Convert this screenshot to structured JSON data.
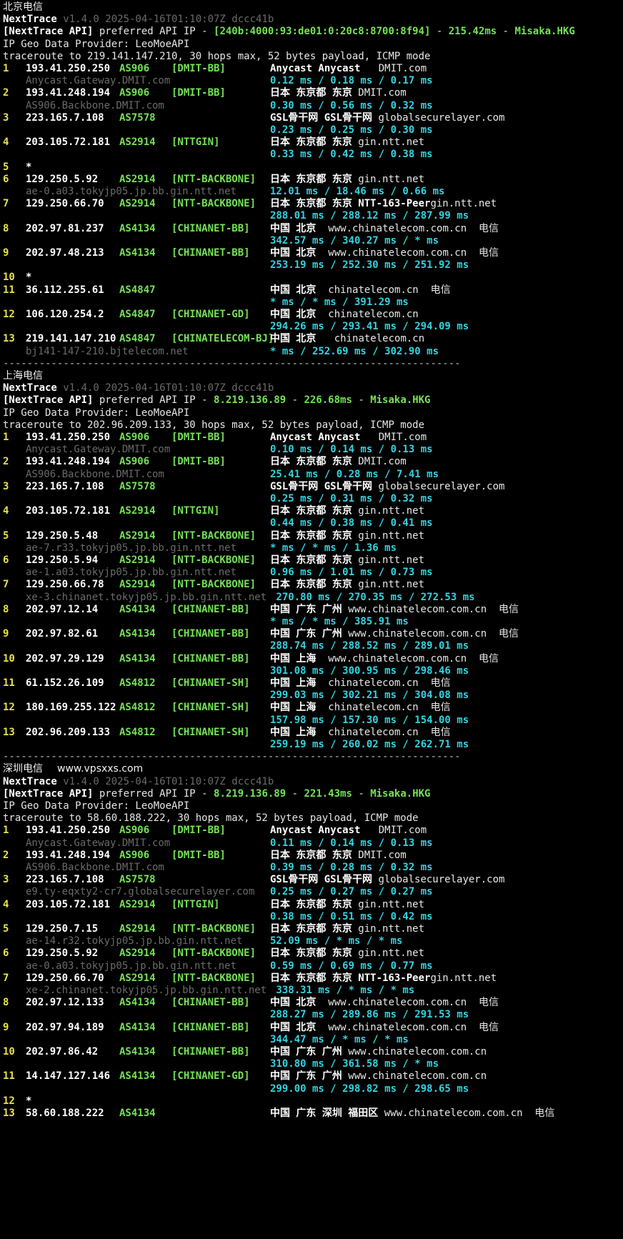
{
  "colors": {
    "background": "#000000",
    "text": "#e6e6e6",
    "cyan": "#33d3e0",
    "green": "#74e255",
    "yellow": "#e8e24a",
    "dim": "#6a6a6a"
  },
  "sections": [
    {
      "title": "北京电信",
      "site": "",
      "tool": "NextTrace",
      "version": "v1.4.0 2025-04-16T01:10:07Z dccc41b",
      "api_label": "[NextTrace API]",
      "api_text": " preferred API IP - ",
      "api_ip": "[240b:4000:93:de01:0:20c8:8700:8f94]",
      "api_sep1": " - ",
      "api_latency": "215.42ms",
      "api_sep2": " - ",
      "api_node": "Misaka.HKG",
      "geo_provider": "IP Geo Data Provider: LeoMoeAPI",
      "traceroute": "traceroute to 219.141.147.210, 30 hops max, 52 bytes payload, ICMP mode",
      "hops": [
        {
          "n": "1",
          "ip": "193.41.250.250",
          "asn": "AS906",
          "tag": "[DMIT-BB]",
          "geo": "Anycast Anycast ",
          "org": "  DMIT.com",
          "rdns": "Anycast.Gateway.DMIT.com",
          "rtt": "0.12 ms / 0.18 ms / 0.17 ms"
        },
        {
          "n": "2",
          "ip": "193.41.248.194",
          "asn": "AS906",
          "tag": "[DMIT-BB]",
          "geo": "日本 东京都 东京 ",
          "org": "DMIT.com",
          "rdns": "AS906.Backbone.DMIT.com",
          "rtt": "0.30 ms / 0.56 ms / 0.32 ms"
        },
        {
          "n": "3",
          "ip": "223.165.7.108",
          "asn": "AS7578",
          "tag": "",
          "geo": "GSL骨干网 GSL骨干网 ",
          "org": "globalsecurelayer.com",
          "rdns": "",
          "rtt": "0.23 ms / 0.25 ms / 0.30 ms"
        },
        {
          "n": "4",
          "ip": "203.105.72.181",
          "asn": "AS2914",
          "tag": "[NTTGIN]",
          "geo": "日本 东京都 东京 ",
          "org": "gin.ntt.net",
          "rdns": "",
          "rtt": "0.33 ms / 0.42 ms / 0.38 ms"
        },
        {
          "n": "5",
          "ip": "*",
          "asn": "",
          "tag": "",
          "geo": "",
          "org": "",
          "rdns": "",
          "rtt": ""
        },
        {
          "n": "6",
          "ip": "129.250.5.92",
          "asn": "AS2914",
          "tag": "[NTT-BACKBONE]",
          "geo": "日本 东京都 东京 ",
          "org": "gin.ntt.net",
          "rdns": "ae-0.a03.tokyjp05.jp.bb.gin.ntt.net",
          "rtt": "12.01 ms / 18.46 ms / 0.66 ms"
        },
        {
          "n": "7",
          "ip": "129.250.66.70",
          "asn": "AS2914",
          "tag": "[NTT-BACKBONE]",
          "geo": "日本 东京都 东京 NTT-163-Peer",
          "org": "gin.ntt.net",
          "rdns": "",
          "rtt": "288.01 ms / 288.12 ms / 287.99 ms"
        },
        {
          "n": "8",
          "ip": "202.97.81.237",
          "asn": "AS4134",
          "tag": "[CHINANET-BB]",
          "geo": "中国 北京  ",
          "org": "www.chinatelecom.com.cn  电信",
          "rdns": "",
          "rtt": "342.57 ms / 340.27 ms / * ms"
        },
        {
          "n": "9",
          "ip": "202.97.48.213",
          "asn": "AS4134",
          "tag": "[CHINANET-BB]",
          "geo": "中国 北京  ",
          "org": "www.chinatelecom.com.cn  电信",
          "rdns": "",
          "rtt": "253.19 ms / 252.30 ms / 251.92 ms"
        },
        {
          "n": "10",
          "ip": "*",
          "asn": "",
          "tag": "",
          "geo": "",
          "org": "",
          "rdns": "",
          "rtt": ""
        },
        {
          "n": "11",
          "ip": "36.112.255.61",
          "asn": "AS4847",
          "tag": "",
          "geo": "中国 北京  ",
          "org": "chinatelecom.cn  电信",
          "rdns": "",
          "rtt": "* ms / * ms / 391.29 ms"
        },
        {
          "n": "12",
          "ip": "106.120.254.2",
          "asn": "AS4847",
          "tag": "[CHINANET-GD]",
          "geo": "中国 北京  ",
          "org": "chinatelecom.cn",
          "rdns": "",
          "rtt": "294.26 ms / 293.41 ms / 294.09 ms"
        },
        {
          "n": "13",
          "ip": "219.141.147.210",
          "asn": "AS4847",
          "tag": "[CHINATELECOM-BJ]",
          "geo": "中国 北京  ",
          "org": " chinatelecom.cn",
          "rdns": "bj141-147-210.bjtelecom.net",
          "rtt": "* ms / 252.69 ms / 302.90 ms"
        }
      ]
    },
    {
      "title": "上海电信",
      "site": "",
      "tool": "NextTrace",
      "version": "v1.4.0 2025-04-16T01:10:07Z dccc41b",
      "api_label": "[NextTrace API]",
      "api_text": " preferred API IP - ",
      "api_ip": "8.219.136.89",
      "api_sep1": " - ",
      "api_latency": "226.68ms",
      "api_sep2": " - ",
      "api_node": "Misaka.HKG",
      "geo_provider": "IP Geo Data Provider: LeoMoeAPI",
      "traceroute": "traceroute to 202.96.209.133, 30 hops max, 52 bytes payload, ICMP mode",
      "hops": [
        {
          "n": "1",
          "ip": "193.41.250.250",
          "asn": "AS906",
          "tag": "[DMIT-BB]",
          "geo": "Anycast Anycast ",
          "org": "  DMIT.com",
          "rdns": "Anycast.Gateway.DMIT.com",
          "rtt": "0.10 ms / 0.14 ms / 0.13 ms"
        },
        {
          "n": "2",
          "ip": "193.41.248.194",
          "asn": "AS906",
          "tag": "[DMIT-BB]",
          "geo": "日本 东京都 东京 ",
          "org": "DMIT.com",
          "rdns": "AS906.Backbone.DMIT.com",
          "rtt": "25.41 ms / 0.28 ms / 7.41 ms"
        },
        {
          "n": "3",
          "ip": "223.165.7.108",
          "asn": "AS7578",
          "tag": "",
          "geo": "GSL骨干网 GSL骨干网 ",
          "org": "globalsecurelayer.com",
          "rdns": "",
          "rtt": "0.25 ms / 0.31 ms / 0.32 ms"
        },
        {
          "n": "4",
          "ip": "203.105.72.181",
          "asn": "AS2914",
          "tag": "[NTTGIN]",
          "geo": "日本 东京都 东京 ",
          "org": "gin.ntt.net",
          "rdns": "",
          "rtt": "0.44 ms / 0.38 ms / 0.41 ms"
        },
        {
          "n": "5",
          "ip": "129.250.5.48",
          "asn": "AS2914",
          "tag": "[NTT-BACKBONE]",
          "geo": "日本 东京都 东京 ",
          "org": "gin.ntt.net",
          "rdns": "ae-7.r33.tokyjp05.jp.bb.gin.ntt.net",
          "rtt": "* ms / * ms / 1.36 ms"
        },
        {
          "n": "6",
          "ip": "129.250.5.94",
          "asn": "AS2914",
          "tag": "[NTT-BACKBONE]",
          "geo": "日本 东京都 东京 ",
          "org": "gin.ntt.net",
          "rdns": "ae-1.a03.tokyjp05.jp.bb.gin.ntt.net",
          "rtt": "0.96 ms / 1.01 ms / 0.73 ms"
        },
        {
          "n": "7",
          "ip": "129.250.66.78",
          "asn": "AS2914",
          "tag": "[NTT-BACKBONE]",
          "geo": "日本 东京都 东京 ",
          "org": "gin.ntt.net",
          "rdns": "xe-3.chinanet.tokyjp05.jp.bb.gin.ntt.net",
          "rtt": " 270.80 ms / 270.35 ms / 272.53 ms"
        },
        {
          "n": "8",
          "ip": "202.97.12.14",
          "asn": "AS4134",
          "tag": "[CHINANET-BB]",
          "geo": "中国 广东 广州 ",
          "org": "www.chinatelecom.com.cn  电信",
          "rdns": "",
          "rtt": "* ms / * ms / 385.91 ms"
        },
        {
          "n": "9",
          "ip": "202.97.82.61",
          "asn": "AS4134",
          "tag": "[CHINANET-BB]",
          "geo": "中国 广东 广州 ",
          "org": "www.chinatelecom.com.cn  电信",
          "rdns": "",
          "rtt": "288.74 ms / 288.52 ms / 289.01 ms"
        },
        {
          "n": "10",
          "ip": "202.97.29.129",
          "asn": "AS4134",
          "tag": "[CHINANET-BB]",
          "geo": "中国 上海  ",
          "org": "www.chinatelecom.com.cn  电信",
          "rdns": "",
          "rtt": "301.08 ms / 300.95 ms / 298.46 ms"
        },
        {
          "n": "11",
          "ip": "61.152.26.109",
          "asn": "AS4812",
          "tag": "[CHINANET-SH]",
          "geo": "中国 上海  ",
          "org": "chinatelecom.cn  电信",
          "rdns": "",
          "rtt": "299.03 ms / 302.21 ms / 304.08 ms"
        },
        {
          "n": "12",
          "ip": "180.169.255.122",
          "asn": "AS4812",
          "tag": "[CHINANET-SH]",
          "geo": "中国 上海  ",
          "org": "chinatelecom.cn  电信",
          "rdns": "",
          "rtt": "157.98 ms / 157.30 ms / 154.00 ms"
        },
        {
          "n": "13",
          "ip": "202.96.209.133",
          "asn": "AS4812",
          "tag": "[CHINANET-SH]",
          "geo": "中国 上海  ",
          "org": "chinatelecom.cn  电信",
          "rdns": "",
          "rtt": "259.19 ms / 260.02 ms / 262.71 ms"
        }
      ]
    },
    {
      "title": "深圳电信",
      "site": "www.vpsxxs.com",
      "tool": "NextTrace",
      "version": "v1.4.0 2025-04-16T01:10:07Z dccc41b",
      "api_label": "[NextTrace API]",
      "api_text": " preferred API IP - ",
      "api_ip": "8.219.136.89",
      "api_sep1": " - ",
      "api_latency": "221.43ms",
      "api_sep2": " - ",
      "api_node": "Misaka.HKG",
      "geo_provider": "IP Geo Data Provider: LeoMoeAPI",
      "traceroute": "traceroute to 58.60.188.222, 30 hops max, 52 bytes payload, ICMP mode",
      "hops": [
        {
          "n": "1",
          "ip": "193.41.250.250",
          "asn": "AS906",
          "tag": "[DMIT-BB]",
          "geo": "Anycast Anycast ",
          "org": "  DMIT.com",
          "rdns": "Anycast.Gateway.DMIT.com",
          "rtt": "0.11 ms / 0.14 ms / 0.13 ms"
        },
        {
          "n": "2",
          "ip": "193.41.248.194",
          "asn": "AS906",
          "tag": "[DMIT-BB]",
          "geo": "日本 东京都 东京 ",
          "org": "DMIT.com",
          "rdns": "AS906.Backbone.DMIT.com",
          "rtt": "0.39 ms / 0.28 ms / 0.32 ms"
        },
        {
          "n": "3",
          "ip": "223.165.7.108",
          "asn": "AS7578",
          "tag": "",
          "geo": "GSL骨干网 GSL骨干网 ",
          "org": "globalsecurelayer.com",
          "rdns": "e9.ty-eqxty2-cr7.globalsecurelayer.com",
          "rtt": "0.25 ms / 0.27 ms / 0.27 ms"
        },
        {
          "n": "4",
          "ip": "203.105.72.181",
          "asn": "AS2914",
          "tag": "[NTTGIN]",
          "geo": "日本 东京都 东京 ",
          "org": "gin.ntt.net",
          "rdns": "",
          "rtt": "0.38 ms / 0.51 ms / 0.42 ms"
        },
        {
          "n": "5",
          "ip": "129.250.7.15",
          "asn": "AS2914",
          "tag": "[NTT-BACKBONE]",
          "geo": "日本 东京都 东京 ",
          "org": "gin.ntt.net",
          "rdns": "ae-14.r32.tokyjp05.jp.bb.gin.ntt.net",
          "rtt": "52.09 ms / * ms / * ms"
        },
        {
          "n": "6",
          "ip": "129.250.5.92",
          "asn": "AS2914",
          "tag": "[NTT-BACKBONE]",
          "geo": "日本 东京都 东京 ",
          "org": "gin.ntt.net",
          "rdns": "ae-0.a03.tokyjp05.jp.bb.gin.ntt.net",
          "rtt": "0.59 ms / 0.69 ms / 0.77 ms"
        },
        {
          "n": "7",
          "ip": "129.250.66.70",
          "asn": "AS2914",
          "tag": "[NTT-BACKBONE]",
          "geo": "日本 东京都 东京 NTT-163-Peer",
          "org": "gin.ntt.net",
          "rdns": "xe-2.chinanet.tokyjp05.jp.bb.gin.ntt.net",
          "rtt": " 338.31 ms / * ms / * ms"
        },
        {
          "n": "8",
          "ip": "202.97.12.133",
          "asn": "AS4134",
          "tag": "[CHINANET-BB]",
          "geo": "中国 北京  ",
          "org": "www.chinatelecom.com.cn  电信",
          "rdns": "",
          "rtt": "288.27 ms / 289.86 ms / 291.53 ms"
        },
        {
          "n": "9",
          "ip": "202.97.94.189",
          "asn": "AS4134",
          "tag": "[CHINANET-BB]",
          "geo": "中国 北京  ",
          "org": "www.chinatelecom.com.cn  电信",
          "rdns": "",
          "rtt": "344.47 ms / * ms / * ms"
        },
        {
          "n": "10",
          "ip": "202.97.86.42",
          "asn": "AS4134",
          "tag": "[CHINANET-BB]",
          "geo": "中国 广东 广州 ",
          "org": "www.chinatelecom.com.cn",
          "rdns": "",
          "rtt": "310.80 ms / 361.58 ms / * ms"
        },
        {
          "n": "11",
          "ip": "14.147.127.146",
          "asn": "AS4134",
          "tag": "[CHINANET-GD]",
          "geo": "中国 广东 广州 ",
          "org": "www.chinatelecom.com.cn",
          "rdns": "",
          "rtt": "299.00 ms / 298.82 ms / 298.65 ms"
        },
        {
          "n": "12",
          "ip": "*",
          "asn": "",
          "tag": "",
          "geo": "",
          "org": "",
          "rdns": "",
          "rtt": ""
        },
        {
          "n": "13",
          "ip": "58.60.188.222",
          "asn": "AS4134",
          "tag": "",
          "geo": "中国 广东 深圳 福田区 ",
          "org": "www.chinatelecom.com.cn  电信",
          "rdns": "",
          "rtt": ""
        }
      ]
    }
  ],
  "separator": "----------------------------------------------------------------------------"
}
